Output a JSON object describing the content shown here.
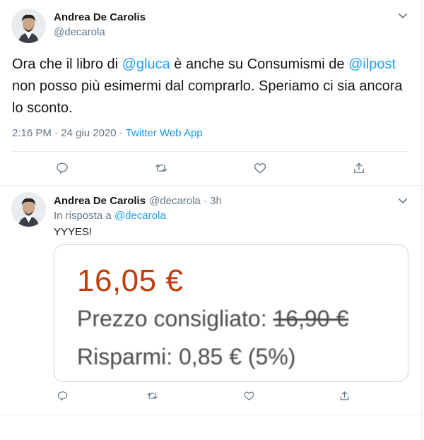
{
  "tweet": {
    "author": {
      "name": "Andrea De Carolis",
      "handle": "@decarola"
    },
    "text_parts": {
      "p1": "Ora che il libro di ",
      "m1": "@gluca",
      "p2": " è anche su Consumismi de ",
      "m2": "@ilpost",
      "p3": " non posso più esimermi dal comprarlo. Speriamo ci sia ancora lo sconto."
    },
    "time": "2:16 PM",
    "sep1": " · ",
    "date": "24 giu 2020",
    "sep2": " · ",
    "app": "Twitter Web App"
  },
  "reply": {
    "author": {
      "name": "Andrea De Carolis",
      "handle": "@decarola",
      "age": "3h"
    },
    "reply_prefix": "In risposta a ",
    "reply_to": "@decarola",
    "text": "YYYES!",
    "card": {
      "price": "16,05 €",
      "list_label": "Prezzo consigliato: ",
      "list_price": "16,90 €",
      "savings": "Risparmi: 0,85 € (5%)"
    }
  },
  "icons": [
    "chevron-down-icon",
    "reply-icon",
    "retweet-icon",
    "like-icon",
    "share-icon"
  ],
  "colors": {
    "link": "#1da1f2",
    "secondary_text": "#657786",
    "price": "#c13b0d",
    "border": "#e6ecf0"
  }
}
